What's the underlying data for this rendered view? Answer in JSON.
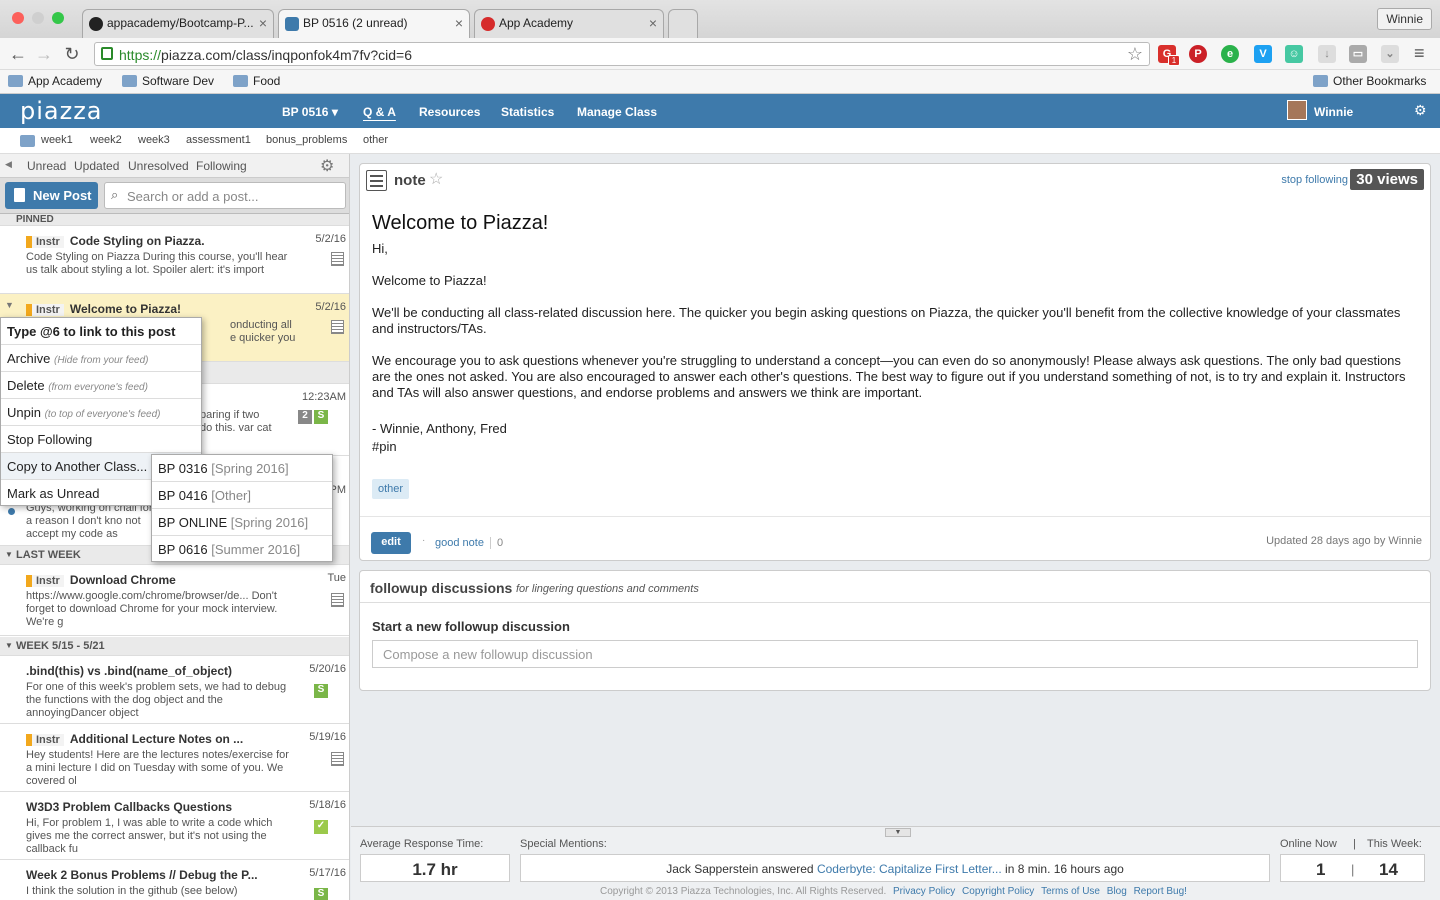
{
  "browser": {
    "tabs": [
      {
        "label": "appacademy/Bootcamp-P..."
      },
      {
        "label": "BP 0516 (2 unread)"
      },
      {
        "label": "App Academy"
      }
    ],
    "profile": "Winnie",
    "url_scheme": "https://",
    "url_rest": "piazza.com/class/inqponfok4m7fv?cid=6",
    "ext_badge": "1",
    "bookmarks": [
      "App Academy",
      "Software Dev",
      "Food"
    ],
    "other_bookmarks": "Other Bookmarks"
  },
  "nav": {
    "logo": "piazza",
    "class": "BP 0516 ▾",
    "items": [
      "Q & A",
      "Resources",
      "Statistics",
      "Manage Class"
    ],
    "user": "Winnie"
  },
  "folders": [
    "week1",
    "week2",
    "week3",
    "assessment1",
    "bonus_problems",
    "other"
  ],
  "filters": [
    "Unread",
    "Updated",
    "Unresolved",
    "Following"
  ],
  "new_post": "New Post",
  "search_placeholder": "Search or add a post...",
  "sections": {
    "pinned": "PINNED",
    "last_week": "LAST WEEK",
    "week": "WEEK 5/15 - 5/21"
  },
  "posts": [
    {
      "instr": "Instr",
      "title": "Code Styling on Piazza.",
      "date": "5/2/16",
      "snippet": "Code Styling on Piazza During this course, you'll hear us talk about styling a lot. Spoiler alert: it's import"
    },
    {
      "instr": "Instr",
      "title": "Welcome to Piazza!",
      "date": "5/2/16",
      "snippet_1": "onducting all",
      "snippet_2": "e quicker you"
    },
    {
      "date": "12:23AM",
      "badge": "2",
      "s": "S",
      "snippet_1": "paring if two",
      "snippet_2": "do this. var cat"
    },
    {
      "date": "PM",
      "snippet": "Guys, working on chall for a reason I don't kno not accept my code as"
    },
    {
      "instr": "Instr",
      "title": "Download Chrome",
      "date": "Tue",
      "snippet": "https://www.google.com/chrome/browser/de... Don't forget to download Chrome for your mock interview. We're g"
    },
    {
      "title": ".bind(this) vs .bind(name_of_object)",
      "date": "5/20/16",
      "s": "S",
      "snippet": "For one of this week's problem sets, we had to debug the functions with the dog object and the annoyingDancer object"
    },
    {
      "instr": "Instr",
      "title": "Additional Lecture Notes on ...",
      "date": "5/19/16",
      "snippet": "Hey students! Here are the lectures notes/exercise for a mini lecture I did on Tuesday with some of you. We covered ol"
    },
    {
      "title": "W3D3 Problem Callbacks Questions",
      "date": "5/18/16",
      "snippet": "Hi, For problem 1, I was able to write a code which gives me the correct answer, but it's not using the callback fu"
    },
    {
      "title": "Week 2 Bonus Problems // Debug the P...",
      "date": "5/17/16",
      "s": "S",
      "snippet": "I think the solution in the github (see below)"
    }
  ],
  "context_menu": {
    "header": "Type @6 to link to this post",
    "items": [
      {
        "label": "Archive",
        "hint": "(Hide from your feed)"
      },
      {
        "label": "Delete",
        "hint": "(from everyone's feed)"
      },
      {
        "label": "Unpin",
        "hint": "(to top of everyone's feed)"
      },
      {
        "label": "Stop Following",
        "hint": ""
      },
      {
        "label": "Copy to Another Class...",
        "hint": ""
      },
      {
        "label": "Mark as Unread",
        "hint": ""
      }
    ],
    "submenu": [
      {
        "name": "BP 0316",
        "term": "[Spring 2016]"
      },
      {
        "name": "BP 0416",
        "term": "[Other]"
      },
      {
        "name": "BP ONLINE",
        "term": "[Spring 2016]"
      },
      {
        "name": "BP 0616",
        "term": "[Summer 2016]"
      }
    ]
  },
  "note": {
    "type": "note",
    "stop_following": "stop following",
    "views": "30 views",
    "title": "Welcome to Piazza!",
    "paragraphs": [
      "Hi,",
      "Welcome to Piazza!",
      "We'll be conducting all class-related discussion here. The quicker you begin asking questions on Piazza, the quicker you'll benefit from the collective knowledge of your classmates and instructors/TAs.",
      "We encourage you to ask questions whenever you're struggling to understand a concept—you can even do so anonymously! Please always ask questions. The only bad questions are the ones not asked. You are also encouraged to answer each other's questions. The best way to figure out if you understand something of not, is to try and explain it. Instructors and TAs will also answer questions, and endorse problems and answers we think are important.",
      "- Winnie, Anthony, Fred",
      "#pin"
    ],
    "tag": "other",
    "edit": "edit",
    "good_note": "good note",
    "good_count": "0",
    "updated": "Updated 28 days ago by Winnie"
  },
  "followup": {
    "title": "followup discussions",
    "subtitle": "for lingering questions and comments",
    "start": "Start a new followup discussion",
    "placeholder": "Compose a new followup discussion"
  },
  "footer": {
    "avg_label": "Average Response Time:",
    "avg_value": "1.7 hr",
    "mentions_label": "Special Mentions:",
    "mention_user": "Jack Sapperstein answered",
    "mention_link": "Coderbyte: Capitalize First Letter...",
    "mention_time": "in 8 min. 16 hours ago",
    "online_label": "Online Now",
    "sep": "|",
    "week_label": "This Week:",
    "online_value": "1",
    "week_value": "14",
    "copyright": "Copyright © 2013 Piazza Technologies, Inc. All Rights Reserved.",
    "links": [
      "Privacy Policy",
      "Copyright Policy",
      "Terms of Use",
      "Blog",
      "Report Bug!"
    ]
  }
}
